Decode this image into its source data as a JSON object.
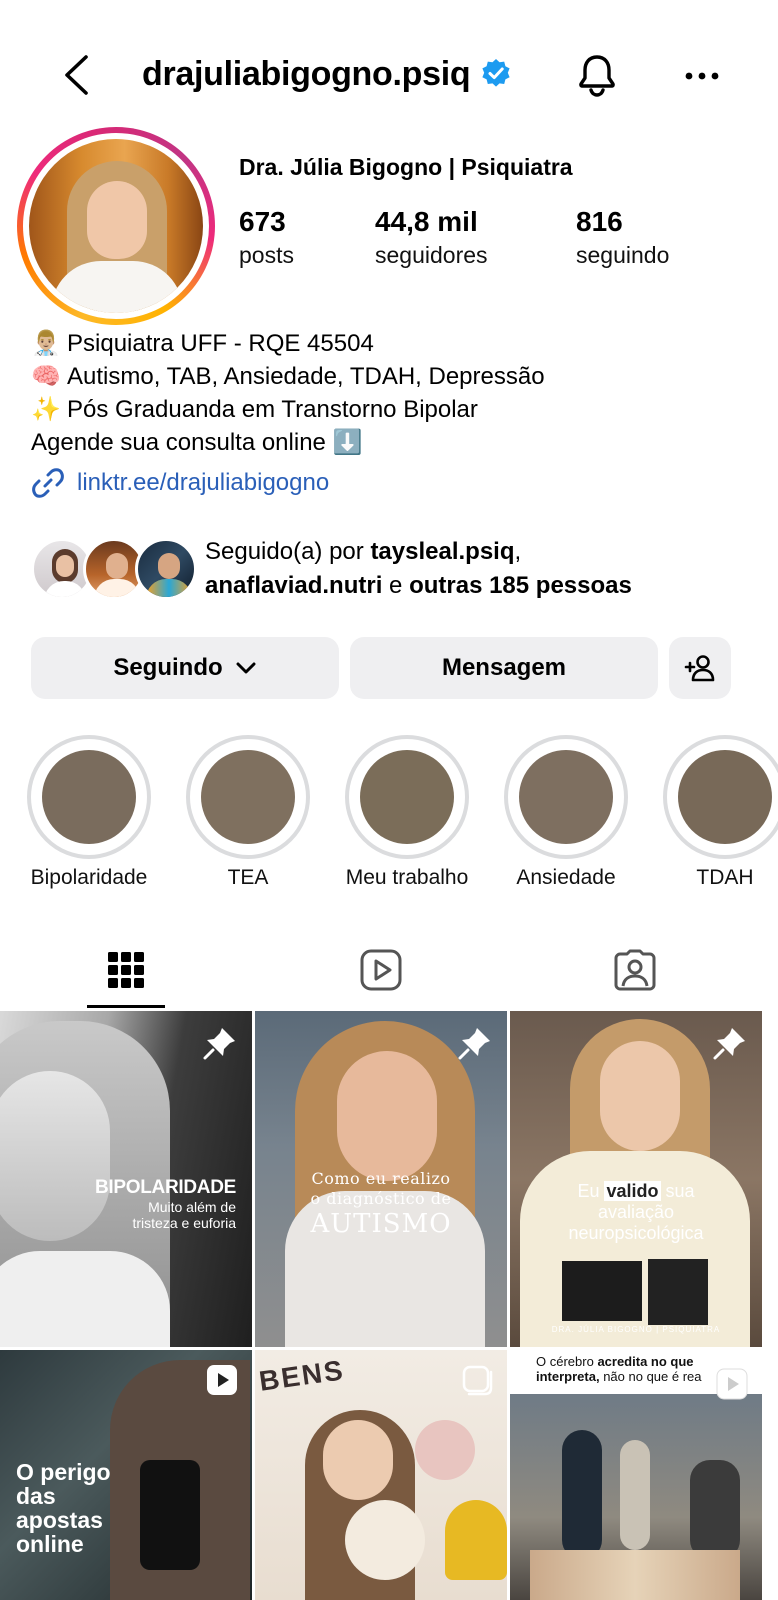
{
  "header": {
    "username": "drajuliabigogno.psiq"
  },
  "profile": {
    "display_name": "Dra. Júlia Bigogno | Psiquiatra",
    "stats": {
      "posts_count": "673",
      "posts_label": "posts",
      "followers_count": "44,8 mil",
      "followers_label": "seguidores",
      "following_count": "816",
      "following_label": "seguindo"
    },
    "bio": [
      {
        "emoji": "👨🏼‍⚕️",
        "text": "Psiquiatra UFF - RQE 45504"
      },
      {
        "emoji": "🧠",
        "text": "Autismo, TAB, Ansiedade, TDAH, Depressão"
      },
      {
        "emoji": "✨",
        "text": "Pós Graduanda em Transtorno Bipolar"
      },
      {
        "emoji": "",
        "text": "Agende sua consulta online ⬇️"
      }
    ],
    "link": "linktr.ee/drajuliabigogno",
    "followed_by": {
      "prefix": "Seguido(a) por ",
      "user1": "taysleal.psiq",
      "sep": ",",
      "user2": "anaflaviad.nutri",
      "conj": " e ",
      "others": "outras 185 pessoas"
    }
  },
  "actions": {
    "following_label": "Seguindo",
    "message_label": "Mensagem"
  },
  "highlights": [
    {
      "label": "Bipolaridade"
    },
    {
      "label": "TEA"
    },
    {
      "label": "Meu trabalho"
    },
    {
      "label": "Ansiedade"
    },
    {
      "label": "TDAH"
    }
  ],
  "posts": [
    {
      "title": "BIPOLARIDADE",
      "subtitle": "Muito além de\ntristeza e euforia",
      "pinned": true
    },
    {
      "title": "Como eu realizo\no diagnóstico de",
      "subtitle": "AUTISMO",
      "pinned": true
    },
    {
      "title": "Eu validos sua",
      "pinned": true,
      "lines": [
        "Eu",
        "valido",
        "sua",
        "avaliação",
        "neuropsicológica"
      ],
      "footer": "DRA. JÚLIA BIGOGNO | PSIQUIATRA"
    },
    {
      "title": "O perigo\ndas\napostas\nonline",
      "reel": true
    },
    {
      "title": "BENS",
      "reel": true
    },
    {
      "title": "O cérebro",
      "bold": "acredita no que\ninterpreta,",
      "rest": " não no que é rea",
      "reel": true
    }
  ],
  "colors": {
    "verified": "#1d9bf0",
    "link": "#2a5fb8",
    "button_bg": "#efeff1",
    "highlight_disc": "#7a6c5d"
  }
}
